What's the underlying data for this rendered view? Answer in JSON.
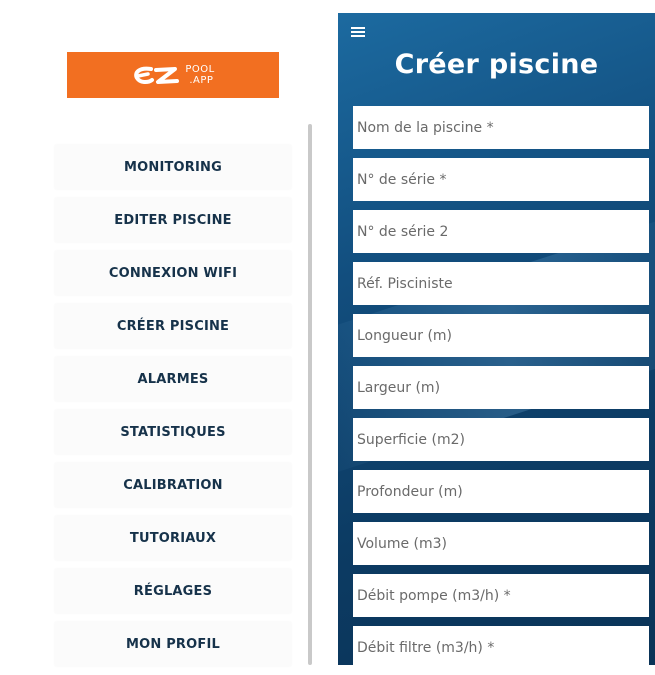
{
  "logo": {
    "line1": "POOL",
    "line2": ".APP",
    "color": "#f26f21"
  },
  "sidebar": {
    "items": [
      {
        "label": "MONITORING"
      },
      {
        "label": "EDITER PISCINE"
      },
      {
        "label": "CONNEXION WIFI"
      },
      {
        "label": "CRÉER PISCINE"
      },
      {
        "label": "ALARMES"
      },
      {
        "label": "STATISTIQUES"
      },
      {
        "label": "CALIBRATION"
      },
      {
        "label": "TUTORIAUX"
      },
      {
        "label": "RÉGLAGES"
      },
      {
        "label": "MON PROFIL"
      }
    ]
  },
  "header": {
    "menu_icon": "hamburger-icon",
    "title": "Créer piscine"
  },
  "form": {
    "fields": [
      {
        "placeholder": "Nom de la piscine *",
        "value": ""
      },
      {
        "placeholder": "N° de série *",
        "value": ""
      },
      {
        "placeholder": "N° de série 2",
        "value": ""
      },
      {
        "placeholder": "Réf. Pisciniste",
        "value": ""
      },
      {
        "placeholder": "Longueur (m)",
        "value": ""
      },
      {
        "placeholder": "Largeur (m)",
        "value": ""
      },
      {
        "placeholder": "Superficie (m2)",
        "value": ""
      },
      {
        "placeholder": "Profondeur (m)",
        "value": ""
      },
      {
        "placeholder": "Volume (m3)",
        "value": ""
      },
      {
        "placeholder": "Débit pompe (m3/h) *",
        "value": ""
      },
      {
        "placeholder": "Débit filtre (m3/h) *",
        "value": ""
      }
    ]
  },
  "colors": {
    "accent": "#f26f21",
    "menu_text": "#16324a",
    "panel_blue": "#124e7e"
  }
}
